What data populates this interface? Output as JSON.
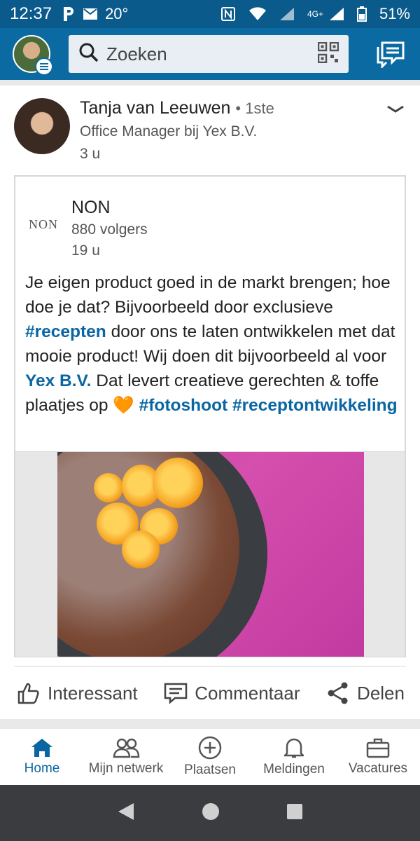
{
  "status_bar": {
    "time": "12:37",
    "temperature": "20°",
    "network": "4G+",
    "battery": "51%"
  },
  "app_bar": {
    "search_placeholder": "Zoeken"
  },
  "post": {
    "author_name": "Tanja van Leeuwen",
    "author_degree": "• 1ste",
    "author_title": "Office Manager bij Yex B.V.",
    "time_ago": "3 u",
    "shared": {
      "logo_text": "NON",
      "company_name": "NON",
      "followers": "880 volgers",
      "time_ago": "19 u",
      "text_part1": "Je eigen product goed in de markt brengen; hoe doe je dat? Bijvoorbeeld door exclusieve ",
      "hashtag_recepten": "#recepten",
      "text_part2": " door ons te laten ontwikkelen met dat mooie product! Wij doen dit bijvoorbeeld al voor ",
      "mention_yex": "Yex B.V.",
      "text_part3": " Dat levert creatieve gerechten & toffe plaatjes op ",
      "emoji_heart": "🧡",
      "hashtag_fotoshoot": "#fotoshoot",
      "hashtag_receptontwikkeling": "#receptontwikkeling"
    },
    "actions": {
      "like": "Interessant",
      "comment": "Commentaar",
      "share": "Delen"
    }
  },
  "bottom_nav": {
    "items": [
      {
        "label": "Home",
        "active": true
      },
      {
        "label": "Mijn netwerk"
      },
      {
        "label": "Plaatsen"
      },
      {
        "label": "Meldingen"
      },
      {
        "label": "Vacatures"
      }
    ]
  },
  "colors": {
    "brand_blue": "#0a6aa1",
    "link_blue": "#0a66a3"
  }
}
